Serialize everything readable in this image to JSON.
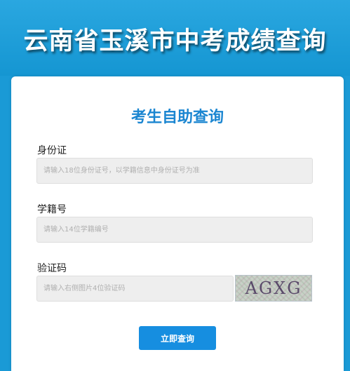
{
  "header": {
    "title": "云南省玉溪市中考成绩查询"
  },
  "card": {
    "title": "考生自助查询",
    "id_card": {
      "label": "身份证",
      "placeholder": "请输入18位身份证号，以学籍信息中身份证号为准",
      "value": ""
    },
    "student_number": {
      "label": "学籍号",
      "placeholder": "请输入14位学籍编号",
      "value": ""
    },
    "captcha": {
      "label": "验证码",
      "placeholder": "请输入右侧图片4位验证码",
      "value": "",
      "image_text": "AGXG"
    },
    "submit_label": "立即查询"
  },
  "colors": {
    "page_background": "#1a9ad6",
    "card_title": "#1b86d1",
    "button": "#168ee0"
  }
}
